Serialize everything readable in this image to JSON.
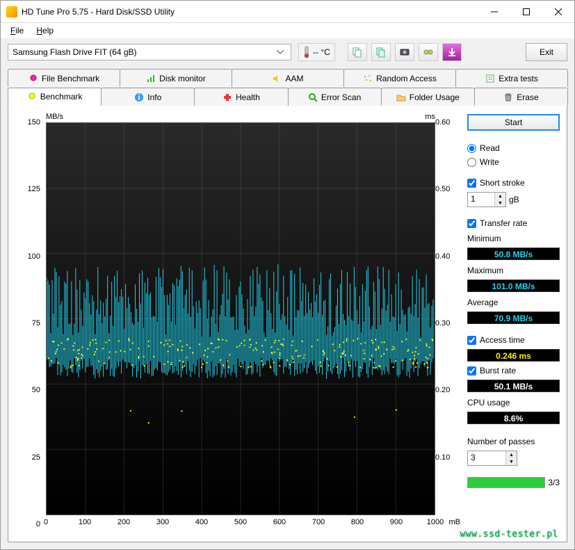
{
  "window": {
    "title": "HD Tune Pro 5.75 - Hard Disk/SSD Utility"
  },
  "menu": {
    "file": "File",
    "help": "Help"
  },
  "toolbar": {
    "drive": "Samsung Flash Drive FIT (64 gB)",
    "temp": "-- °C",
    "exit": "Exit"
  },
  "tabs_row1": [
    {
      "label": "File Benchmark"
    },
    {
      "label": "Disk monitor"
    },
    {
      "label": "AAM"
    },
    {
      "label": "Random Access"
    },
    {
      "label": "Extra tests"
    }
  ],
  "tabs_row2": [
    {
      "label": "Benchmark"
    },
    {
      "label": "Info"
    },
    {
      "label": "Health"
    },
    {
      "label": "Error Scan"
    },
    {
      "label": "Folder Usage"
    },
    {
      "label": "Erase"
    }
  ],
  "side": {
    "start": "Start",
    "read": "Read",
    "write": "Write",
    "short_stroke": "Short stroke",
    "short_stroke_val": "1",
    "short_stroke_unit": "gB",
    "transfer_rate": "Transfer rate",
    "min_label": "Minimum",
    "min_val": "50.8 MB/s",
    "max_label": "Maximum",
    "max_val": "101.0 MB/s",
    "avg_label": "Average",
    "avg_val": "70.9 MB/s",
    "access_time": "Access time",
    "access_val": "0.246 ms",
    "burst_rate": "Burst rate",
    "burst_val": "50.1 MB/s",
    "cpu_label": "CPU usage",
    "cpu_val": "8.6%",
    "passes_label": "Number of passes",
    "passes_val": "3",
    "progress": "3/3"
  },
  "chart_data": {
    "type": "line",
    "title": "",
    "x_unit": "mB",
    "y_left_unit": "MB/s",
    "y_right_unit": "ms",
    "x_range": [
      0,
      1000
    ],
    "y_left_range": [
      0,
      150
    ],
    "y_right_range": [
      0,
      0.6
    ],
    "x_ticks": [
      0,
      100,
      200,
      300,
      400,
      500,
      600,
      700,
      800,
      900,
      1000
    ],
    "y_left_ticks": [
      0,
      25,
      50,
      75,
      100,
      125,
      150
    ],
    "y_right_ticks": [
      0.1,
      0.2,
      0.3,
      0.4,
      0.5,
      0.6
    ],
    "series": [
      {
        "name": "Transfer rate",
        "axis": "left",
        "style": "spikes",
        "color": "#22d3ee",
        "min": 50.8,
        "max": 101.0,
        "avg": 70.9,
        "note": "dense vertical spikes between ~52 and ~95 MB/s across full x range"
      },
      {
        "name": "Access time",
        "axis": "right",
        "style": "dots",
        "color": "#eeff22",
        "avg": 0.246,
        "note": "scattered dots mostly 0.22–0.27 ms with a few outliers near 0.15 ms"
      }
    ]
  },
  "watermark": "www.ssd-tester.pl"
}
